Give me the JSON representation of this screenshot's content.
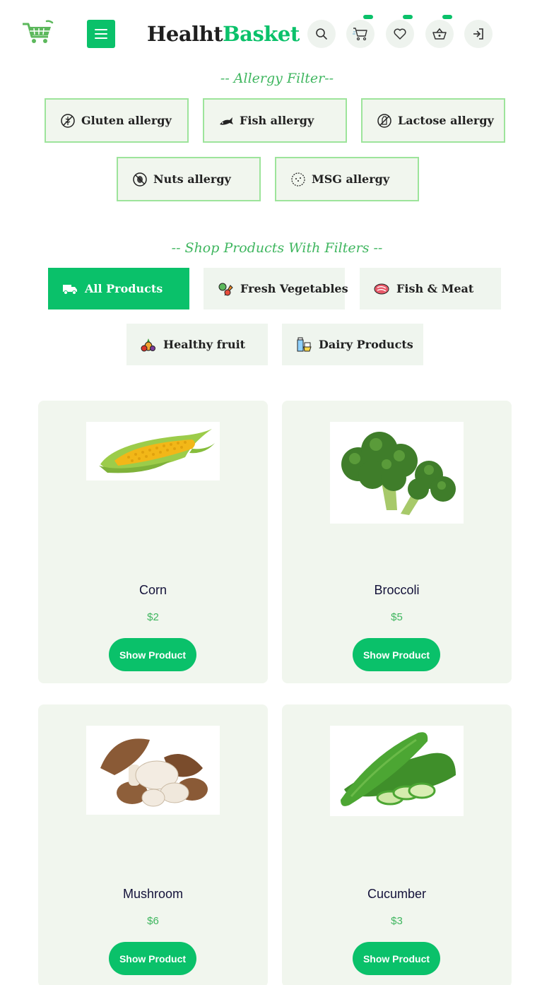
{
  "header": {
    "brand_part1": "Healht",
    "brand_part2": "Basket",
    "logo_icon": "shopping-cart-logo",
    "menu_icon": "hamburger-menu-icon",
    "action_icons": [
      "search-icon",
      "cart-icon",
      "heart-icon",
      "basket-icon",
      "login-icon"
    ],
    "accent_color": "#0ac16a"
  },
  "allergy_filter": {
    "title": "-- Allergy Filter--",
    "items": [
      {
        "label": "Gluten allergy",
        "icon": "no-gluten-icon"
      },
      {
        "label": "Fish allergy",
        "icon": "fish-icon"
      },
      {
        "label": "Lactose allergy",
        "icon": "no-lactose-icon"
      },
      {
        "label": "Nuts allergy",
        "icon": "no-nuts-icon"
      },
      {
        "label": "MSG allergy",
        "icon": "msg-icon"
      }
    ]
  },
  "shop_filter": {
    "title": "-- Shop Products With Filters --",
    "items": [
      {
        "label": "All Products",
        "icon": "truck-icon",
        "active": true
      },
      {
        "label": "Fresh Vegetables",
        "icon": "vegetables-icon",
        "active": false
      },
      {
        "label": "Fish & Meat",
        "icon": "meat-icon",
        "active": false
      },
      {
        "label": "Healthy fruit",
        "icon": "fruit-icon",
        "active": false
      },
      {
        "label": "Dairy Products",
        "icon": "dairy-icon",
        "active": false
      }
    ]
  },
  "products": [
    {
      "name": "Corn",
      "price": "$2",
      "button": "Show Product",
      "image": "corn-image"
    },
    {
      "name": "Broccoli",
      "price": "$5",
      "button": "Show Product",
      "image": "broccoli-image"
    },
    {
      "name": "Mushroom",
      "price": "$6",
      "button": "Show Product",
      "image": "mushroom-image"
    },
    {
      "name": "Cucumber",
      "price": "$3",
      "button": "Show Product",
      "image": "cucumber-image"
    }
  ]
}
